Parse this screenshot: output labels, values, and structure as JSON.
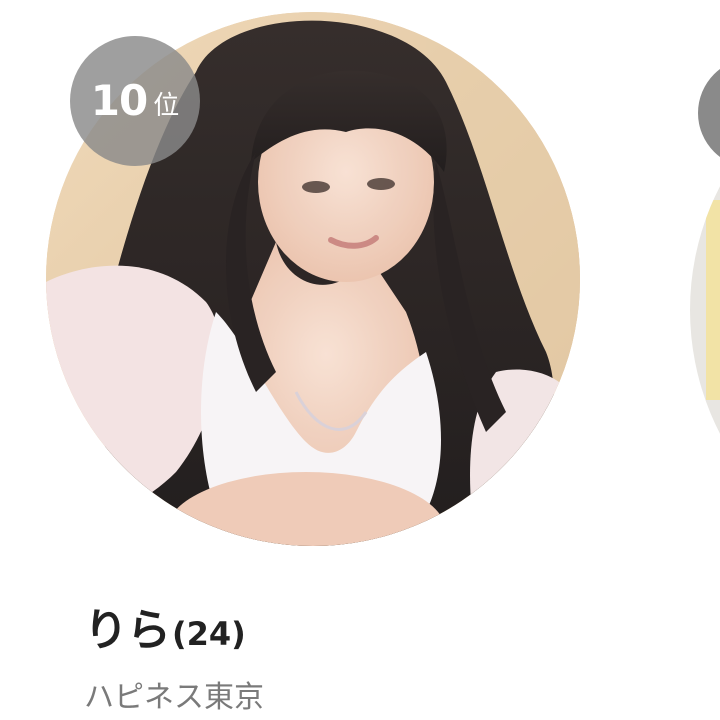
{
  "card": {
    "rank_number": "10",
    "rank_unit": "位",
    "name": "りら",
    "age": "(24)",
    "shop": "ハピネス東京"
  },
  "next_card": {
    "rank_stub": "",
    "name_stub": "",
    "shop_stub": ""
  },
  "colors": {
    "badge": "#8a8a8a",
    "name": "#222222",
    "shop": "#7a7a7a",
    "background": "#ffffff"
  }
}
